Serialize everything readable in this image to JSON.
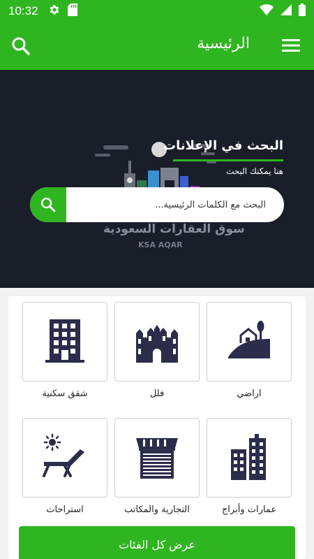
{
  "status_bar": {
    "time": "10:32",
    "icons": [
      "gear-icon",
      "sd-card-icon",
      "wifi-icon",
      "signal-icon",
      "battery-icon"
    ]
  },
  "app_bar": {
    "title": "الرئيسية",
    "icons": [
      "search-icon",
      "hamburger-menu-icon"
    ]
  },
  "hero": {
    "title": "البحث في الإعلانات",
    "subtitle": "هنا يمكنك البحث",
    "brand_arabic": "سوق العقارات السعودية",
    "brand_english": "KSA AQAR",
    "search": {
      "placeholder": "البحث مع الكلمات الرئيسية..."
    }
  },
  "categories": [
    {
      "label": "اراضي",
      "icon": "land-icon"
    },
    {
      "label": "فلل",
      "icon": "villa-icon"
    },
    {
      "label": "شقق سكنية",
      "icon": "apartment-building-icon"
    },
    {
      "label": "عمارات وأبراج",
      "icon": "towers-icon"
    },
    {
      "label": "التجارية والمكاتب",
      "icon": "shop-icon"
    },
    {
      "label": "استراحات",
      "icon": "lounge-chair-icon"
    }
  ],
  "show_all_button": "عرض كل الفئات",
  "colors": {
    "primary": "#2fb51f",
    "hero_bg": "#1a1e28",
    "icon_dark": "#2b2d4a"
  }
}
